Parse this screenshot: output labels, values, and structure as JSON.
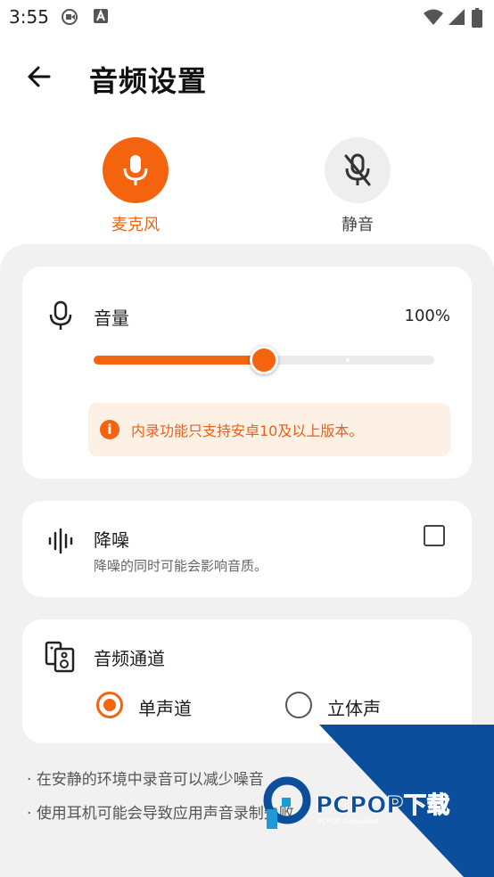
{
  "status_bar": {
    "time": "3:55"
  },
  "header": {
    "title": "音频设置",
    "back_icon": "arrow-left-icon"
  },
  "modes": [
    {
      "label": "麦克风",
      "icon": "microphone-icon",
      "selected": true
    },
    {
      "label": "静音",
      "icon": "microphone-off-icon",
      "selected": false
    }
  ],
  "volume": {
    "label": "音量",
    "value_text": "100%",
    "slider_fraction": 0.5,
    "notice": "内录功能只支持安卓10及以上版本。"
  },
  "denoise": {
    "label": "降噪",
    "description": "降噪的同时可能会影响音质。",
    "checked": false
  },
  "channel": {
    "label": "音频通道",
    "options": [
      {
        "label": "单声道",
        "selected": true
      },
      {
        "label": "立体声",
        "selected": false
      }
    ]
  },
  "tips": [
    "在安静的环境中录音可以减少噪音",
    "使用耳机可能会导致应用声音录制失败。"
  ],
  "watermark": {
    "logo": "PCPOP下载",
    "sub": "PCPOP Download"
  },
  "colors": {
    "accent": "#f4640f",
    "notice_bg": "#fdf1e6",
    "sheet_bg": "#f1f1f1",
    "watermark_blue": "#0b4f9c"
  }
}
